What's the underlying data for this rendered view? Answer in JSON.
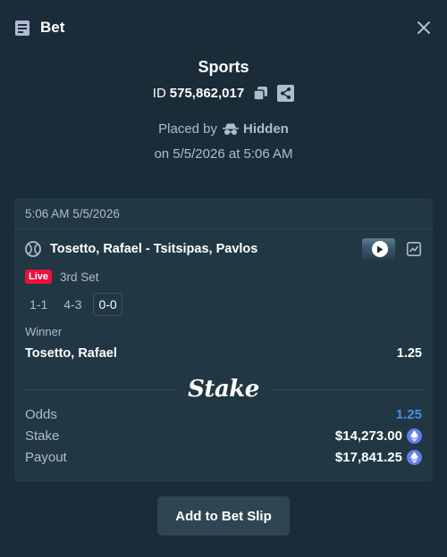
{
  "header": {
    "title": "Bet",
    "icon": "bet-slip-icon",
    "close_icon": "close-icon"
  },
  "summary": {
    "sport": "Sports",
    "id_label": "ID",
    "id_value": "575,862,017",
    "placed_by_label": "Placed by",
    "placed_by_user": "Hidden",
    "date_text": "on 5/5/2026 at 5:06 AM"
  },
  "card": {
    "timestamp": "5:06 AM 5/5/2026",
    "match": "Tosetto, Rafael - Tsitsipas, Pavlos",
    "live_label": "Live",
    "set_label": "3rd Set",
    "scores": [
      "1-1",
      "4-3",
      "0-0"
    ],
    "market": "Winner",
    "outcome": "Tosetto, Rafael",
    "outcome_odds": "1.25",
    "brand": "Stake",
    "details": {
      "odds_label": "Odds",
      "odds_value": "1.25",
      "stake_label": "Stake",
      "stake_value": "$14,273.00",
      "payout_label": "Payout",
      "payout_value": "$17,841.25"
    }
  },
  "actions": {
    "add_label": "Add to Bet Slip"
  },
  "colors": {
    "background": "#1a2c38",
    "card": "#213743",
    "muted": "#b1bad3",
    "live": "#e9113c",
    "odds": "#4390e6",
    "eth": "#627eea"
  }
}
